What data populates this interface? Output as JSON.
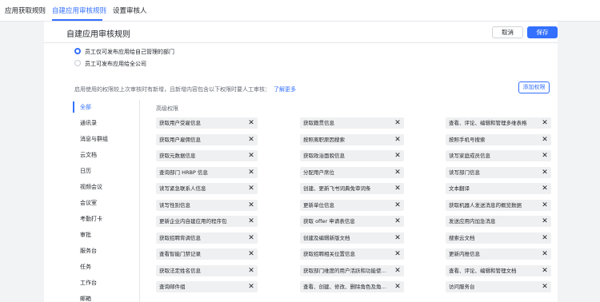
{
  "tabs": [
    {
      "label": "应用获取规则"
    },
    {
      "label": "自建应用审核规则",
      "active": true
    },
    {
      "label": "设置审核人"
    }
  ],
  "header": {
    "title": "自建应用审核规则",
    "cancel_label": "取消",
    "save_label": "保存"
  },
  "options": [
    {
      "label": "员工仅可发布应用给自己管理的部门",
      "selected": true
    },
    {
      "label": "员工可发布应用给全公司",
      "selected": false
    }
  ],
  "hint": {
    "text": "启用使用的权限较上次审核时有新增，且新增内容包含以下权限时要人工审核：",
    "link": "了解更多"
  },
  "add_permission_label": "添加权限",
  "categories": [
    "全部",
    "通讯录",
    "消息与群组",
    "云文档",
    "日历",
    "视频会议",
    "会议室",
    "考勤打卡",
    "审批",
    "服务台",
    "任务",
    "工作台",
    "邮箱"
  ],
  "active_category": "全部",
  "section_title": "高级权限",
  "permissions": [
    [
      "获取用户受雇信息",
      "获取籍贯信息",
      "查看、评论、编辑和管理多维表格"
    ],
    [
      "获取用户雇佣信息",
      "按照离职原因搜索",
      "按照手机号搜索"
    ],
    [
      "获取元数据信息",
      "获取政治面貌信息",
      "读写家庭成员信息"
    ],
    [
      "查询部门 HRBP 信息",
      "分配用户席位",
      "读写部门信息"
    ],
    [
      "读写紧急联系人信息",
      "创建、更新飞书词典免审词条",
      "文本翻译"
    ],
    [
      "读写性别信息",
      "更新单位信息",
      "获取机器人发送消息的概览数据"
    ],
    [
      "更新企业内自建应用的程序包",
      "获取 offer 申请表信息",
      "发送应用内加急消息"
    ],
    [
      "获取招聘背调信息",
      "创建及编辑新版文档",
      "搜索云文档"
    ],
    [
      "查看智能门禁记录",
      "获取招聘相关位置信息",
      "更新内推信息"
    ],
    [
      "获取法定姓名信息",
      "获取部门维度的用户活跃和功能使用数据",
      "查看、评论、编辑和管理文档"
    ],
    [
      "查询邮件组",
      "查看、创建、修改、删除角色及角色成员",
      "访问服务台"
    ]
  ],
  "close_glyph": "✕"
}
